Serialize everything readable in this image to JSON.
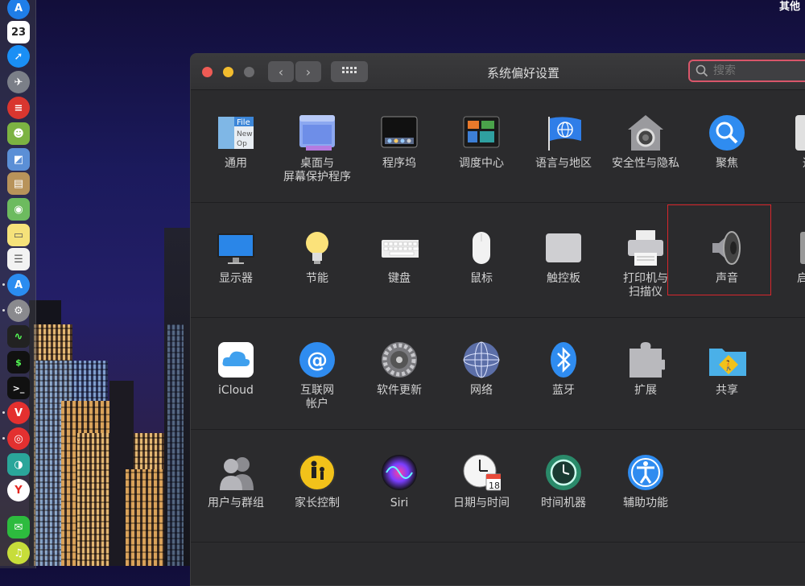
{
  "menubar": {
    "right_text": "其他"
  },
  "dock": {
    "calendar_day": "23",
    "items": [
      "app-store-icon",
      "calendar-icon",
      "safari-icon",
      "launchpad-icon",
      "app-red-icon",
      "android-icon",
      "preview-icon",
      "notes-icon",
      "maps-icon",
      "stickies-icon",
      "textedit-icon",
      "app-store-icon",
      "system-preferences-icon",
      "activity-monitor-icon",
      "terminal-icon",
      "terminal-icon",
      "vivaldi-icon",
      "netease-music-icon",
      "app-teal-icon",
      "yandex-icon",
      "wechat-icon",
      "music-icon"
    ]
  },
  "window": {
    "title": "系统偏好设置",
    "search_placeholder": "搜索",
    "rows": [
      [
        {
          "id": "general",
          "label": "通用",
          "icon": "general-icon"
        },
        {
          "id": "desktop",
          "label": "桌面与\n屏幕保护程序",
          "icon": "desktop-icon"
        },
        {
          "id": "dock",
          "label": "程序坞",
          "icon": "dock-icon"
        },
        {
          "id": "mission",
          "label": "调度中心",
          "icon": "mission-control-icon"
        },
        {
          "id": "language",
          "label": "语言与地区",
          "icon": "flag-globe-icon"
        },
        {
          "id": "security",
          "label": "安全性与隐私",
          "icon": "house-lock-icon"
        },
        {
          "id": "spotlight",
          "label": "聚焦",
          "icon": "spotlight-icon"
        },
        {
          "id": "notify",
          "label": "通",
          "icon": "notification-icon"
        }
      ],
      [
        {
          "id": "displays",
          "label": "显示器",
          "icon": "display-icon"
        },
        {
          "id": "energy",
          "label": "节能",
          "icon": "bulb-icon"
        },
        {
          "id": "keyboard",
          "label": "键盘",
          "icon": "keyboard-icon"
        },
        {
          "id": "mouse",
          "label": "鼠标",
          "icon": "mouse-icon"
        },
        {
          "id": "trackpad",
          "label": "触控板",
          "icon": "trackpad-icon"
        },
        {
          "id": "printers",
          "label": "打印机与\n扫描仪",
          "icon": "printer-icon"
        },
        {
          "id": "sound",
          "label": "声音",
          "icon": "speaker-icon"
        },
        {
          "id": "startup",
          "label": "启动",
          "icon": "startup-disk-icon"
        }
      ],
      [
        {
          "id": "icloud",
          "label": "iCloud",
          "icon": "icloud-icon"
        },
        {
          "id": "internet",
          "label": "互联网\n帐户",
          "icon": "at-icon"
        },
        {
          "id": "update",
          "label": "软件更新",
          "icon": "gear-icon"
        },
        {
          "id": "network",
          "label": "网络",
          "icon": "network-globe-icon"
        },
        {
          "id": "bluetooth",
          "label": "蓝牙",
          "icon": "bluetooth-icon"
        },
        {
          "id": "extensions",
          "label": "扩展",
          "icon": "puzzle-icon"
        },
        {
          "id": "sharing",
          "label": "共享",
          "icon": "sharing-folder-icon"
        }
      ],
      [
        {
          "id": "users",
          "label": "用户与群组",
          "icon": "users-icon"
        },
        {
          "id": "parental",
          "label": "家长控制",
          "icon": "parental-icon"
        },
        {
          "id": "siri",
          "label": "Siri",
          "icon": "siri-icon"
        },
        {
          "id": "datetime",
          "label": "日期与时间",
          "icon": "clock-icon"
        },
        {
          "id": "timemachine",
          "label": "时间机器",
          "icon": "time-machine-icon"
        },
        {
          "id": "accessibility",
          "label": "辅助功能",
          "icon": "accessibility-icon"
        }
      ]
    ],
    "date_badge": "18"
  },
  "colors": {
    "highlight": "#d8262c",
    "search_border": "#d9566a"
  }
}
